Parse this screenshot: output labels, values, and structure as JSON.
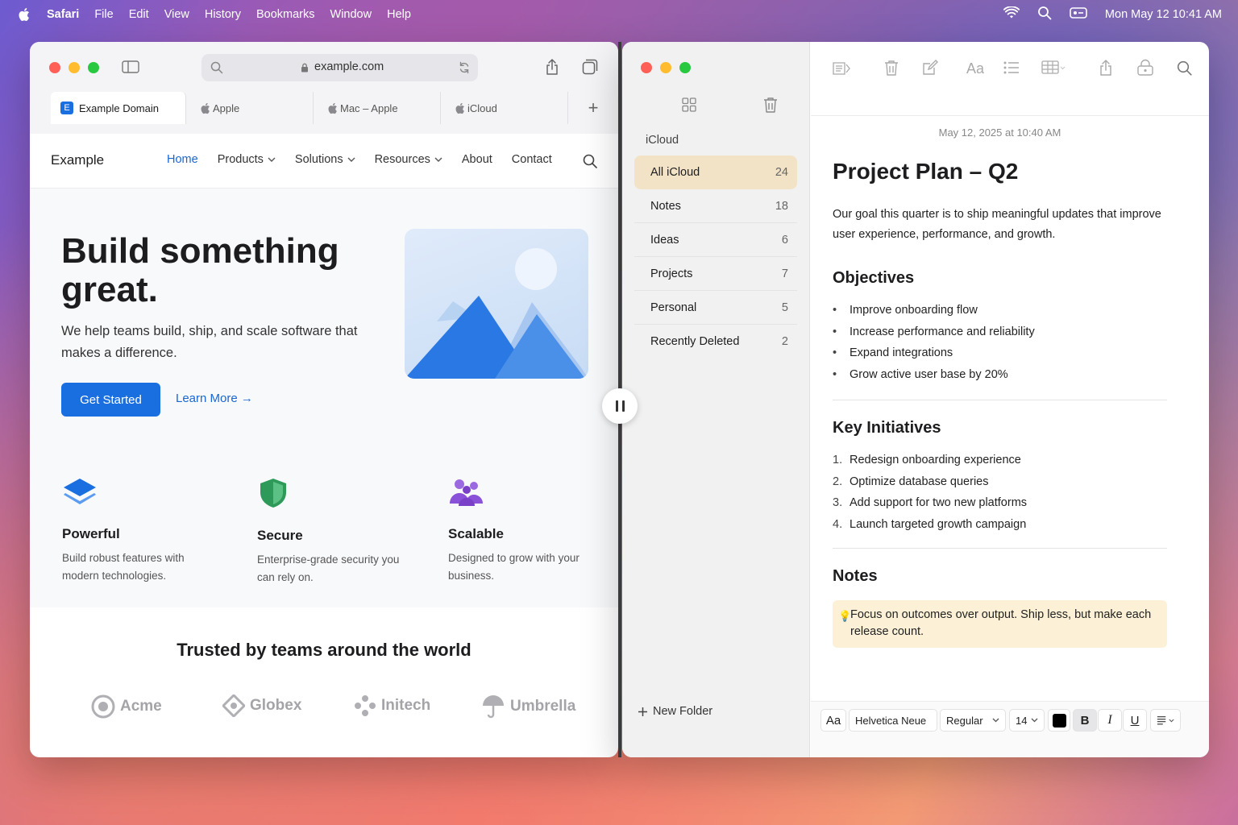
{
  "menubar": {
    "app": "Safari",
    "items": [
      "File",
      "Edit",
      "View",
      "History",
      "Bookmarks",
      "Window",
      "Help"
    ],
    "datetime": "Mon May 12  10:41 AM"
  },
  "safari": {
    "address": "example.com",
    "tabs": [
      {
        "label": "Example Domain",
        "favicon": "E"
      },
      {
        "label": "Apple"
      },
      {
        "label": "Mac – Apple"
      },
      {
        "label": "iCloud"
      }
    ],
    "page": {
      "brand": "Example",
      "nav": [
        "Home",
        "Products",
        "Solutions",
        "Resources",
        "About",
        "Contact"
      ],
      "hero_title": "Build something great.",
      "hero_sub": "We help teams build, ship, and scale software that makes a difference.",
      "cta_primary": "Get Started",
      "cta_secondary": "Learn More →",
      "features": [
        {
          "title": "Powerful",
          "desc": "Build robust features with modern technologies.",
          "icon": "layers-icon",
          "color": "#1a6fe0"
        },
        {
          "title": "Secure",
          "desc": "Enterprise-grade security you can rely on.",
          "icon": "shield-icon",
          "color": "#2e9a5a"
        },
        {
          "title": "Scalable",
          "desc": "Designed to grow with your business.",
          "icon": "users-icon",
          "color": "#8a52d8"
        }
      ],
      "trusted_heading": "Trusted by teams around the world",
      "logos": [
        "Acme",
        "Globex",
        "Initech",
        "Umbrella"
      ]
    }
  },
  "notes": {
    "sidebar_heading": "iCloud",
    "folders": [
      {
        "name": "All iCloud",
        "count": "24"
      },
      {
        "name": "Notes",
        "count": "18"
      },
      {
        "name": "Ideas",
        "count": "6"
      },
      {
        "name": "Projects",
        "count": "7"
      },
      {
        "name": "Personal",
        "count": "5"
      },
      {
        "name": "Recently Deleted",
        "count": "2"
      }
    ],
    "new_folder": "New Folder",
    "note": {
      "date": "May 12, 2025 at 10:40 AM",
      "title": "Project Plan – Q2",
      "intro": "Our goal this quarter is to ship meaningful updates that improve user experience, performance, and growth.",
      "objectives_heading": "Objectives",
      "objectives": [
        "Improve onboarding flow",
        "Increase performance and reliability",
        "Expand integrations",
        "Grow active user base by 20%"
      ],
      "initiatives_heading": "Key Initiatives",
      "initiatives": [
        "Redesign onboarding experience",
        "Optimize database queries",
        "Add support for two new platforms",
        "Launch targeted growth campaign"
      ],
      "notes_heading": "Notes",
      "callout": "Focus on outcomes over output. Ship less, but make each release count."
    },
    "format": {
      "aa": "Aa",
      "font": "Helvetica Neue",
      "style": "Regular",
      "size": "14",
      "bold": "B",
      "italic": "I",
      "underline": "U",
      "text_color": "#000000"
    }
  }
}
